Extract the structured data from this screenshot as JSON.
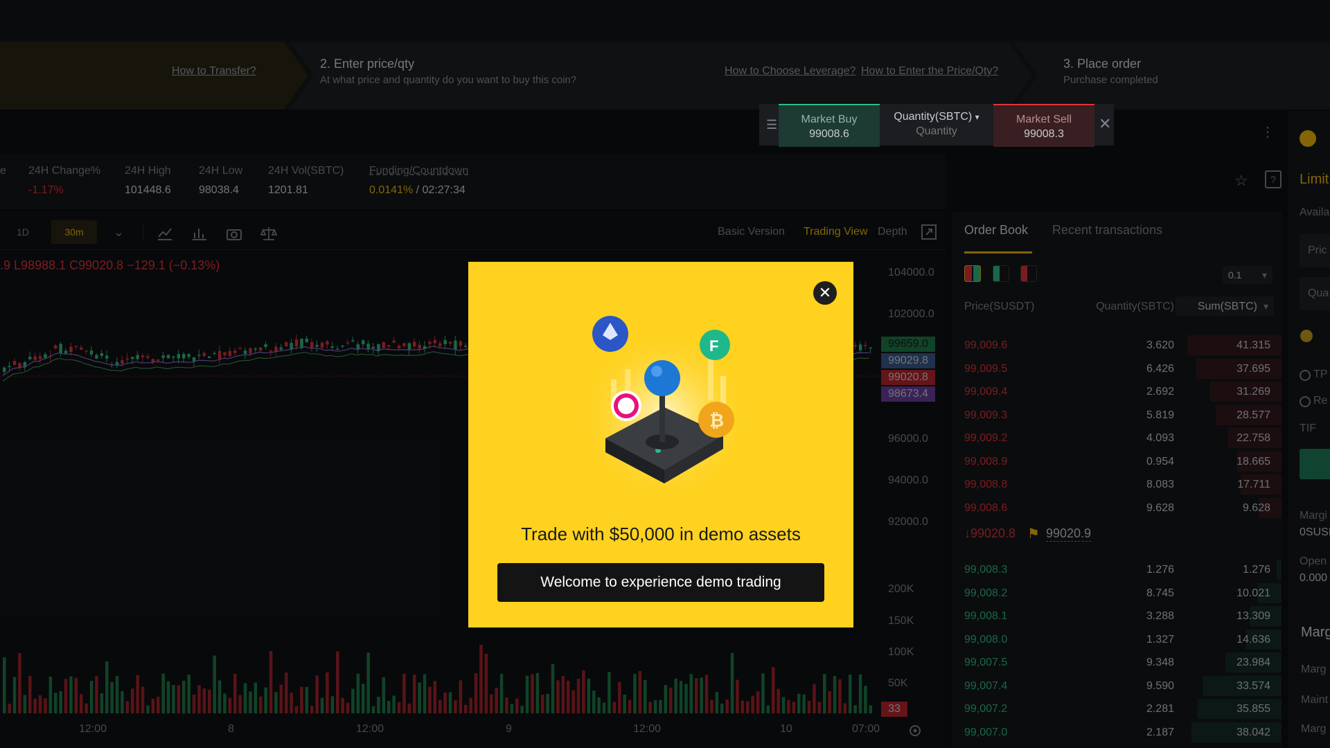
{
  "steps": {
    "link_transfer": "How to Transfer?",
    "step2_title": "2. Enter price/qty",
    "step2_sub": "At what price and quantity do you want to buy this coin?",
    "link_leverage": "How to Choose Leverage?",
    "link_price_qty": "How to Enter the Price/Qty?",
    "step3_title": "3. Place order",
    "step3_sub": "Purchase completed"
  },
  "quick_order": {
    "market_buy_label": "Market Buy",
    "market_buy_price": "99008.6",
    "quantity_label": "Quantity(SBTC)",
    "quantity_placeholder": "Quantity",
    "market_sell_label": "Market Sell",
    "market_sell_price": "99008.3"
  },
  "stats": [
    {
      "k": "24H Change%",
      "v": "-1.17%"
    },
    {
      "k": "24H High",
      "v": "101448.6"
    },
    {
      "k": "24H Low",
      "v": "98038.4"
    },
    {
      "k": "24H Vol(SBTC)",
      "v": "1201.81"
    }
  ],
  "funding": {
    "k": "Funding/Countdown",
    "rate": "0.0141%",
    "sep": " / ",
    "countdown": "02:27:34"
  },
  "chart_tools": {
    "interval_1d": "1D",
    "interval_30m": "30m",
    "basic": "Basic Version",
    "trading_view": "Trading View",
    "depth": "Depth"
  },
  "ohlc": {
    "l": "L98988.1",
    "c": "C99020.8",
    "chg": "−129.1 (−0.13%)",
    "prefix": ".9"
  },
  "price_axis": [
    "104000.0",
    "102000.0",
    "96000.0",
    "94000.0",
    "92000.0"
  ],
  "price_tags": [
    {
      "v": "99659.0",
      "color": "#1f7a4a"
    },
    {
      "v": "99029.8",
      "color": "#3a5a8a"
    },
    {
      "v": "99020.8",
      "color": "#b8272c"
    },
    {
      "v": "98673.4",
      "color": "#6b3fa0"
    }
  ],
  "vol_axis": [
    "200K",
    "150K",
    "100K",
    "50K"
  ],
  "vol_tag": "33",
  "time_axis": [
    "12:00",
    "8",
    "12:00",
    "9",
    "12:00",
    "10",
    "07:00"
  ],
  "orderbook": {
    "tab_book": "Order Book",
    "tab_recent": "Recent transactions",
    "precision": "0.1",
    "h_price": "Price(SUSDT)",
    "h_qty": "Quantity(SBTC)",
    "h_sum": "Sum(SBTC)",
    "asks": [
      {
        "p": "99,009.6",
        "q": "3.620",
        "s": "41.315",
        "w": 0.62
      },
      {
        "p": "99,009.5",
        "q": "6.426",
        "s": "37.695",
        "w": 0.56
      },
      {
        "p": "99,009.4",
        "q": "2.692",
        "s": "31.269",
        "w": 0.47
      },
      {
        "p": "99,009.3",
        "q": "5.819",
        "s": "28.577",
        "w": 0.43
      },
      {
        "p": "99,009.2",
        "q": "4.093",
        "s": "22.758",
        "w": 0.35
      },
      {
        "p": "99,008.9",
        "q": "0.954",
        "s": "18.665",
        "w": 0.29
      },
      {
        "p": "99,008.8",
        "q": "8.083",
        "s": "17.711",
        "w": 0.27
      },
      {
        "p": "99,008.6",
        "q": "9.628",
        "s": "9.628",
        "w": 0.15
      }
    ],
    "last_price": "↓99020.8",
    "mark_price": "99020.9",
    "bids": [
      {
        "p": "99,008.3",
        "q": "1.276",
        "s": "1.276",
        "w": 0.03
      },
      {
        "p": "99,008.2",
        "q": "8.745",
        "s": "10.021",
        "w": 0.16
      },
      {
        "p": "99,008.1",
        "q": "3.288",
        "s": "13.309",
        "w": 0.21
      },
      {
        "p": "99,008.0",
        "q": "1.327",
        "s": "14.636",
        "w": 0.23
      },
      {
        "p": "99,007.5",
        "q": "9.348",
        "s": "23.984",
        "w": 0.37
      },
      {
        "p": "99,007.4",
        "q": "9.590",
        "s": "33.574",
        "w": 0.52
      },
      {
        "p": "99,007.2",
        "q": "2.281",
        "s": "35.855",
        "w": 0.55
      },
      {
        "p": "99,007.0",
        "q": "2.187",
        "s": "38.042",
        "w": 0.59
      }
    ]
  },
  "right_panel": {
    "limit": "Limit",
    "avail": "Availa",
    "price": "Pric",
    "qty": "Qua",
    "tp": "TP",
    "re": "Re",
    "tif": "TIF",
    "marg1": "Margi",
    "marg1v": "0SUSI",
    "open": "Open",
    "openv": "0.000",
    "margin_h": "Marg",
    "marg2": "Marg",
    "maint": "Maint",
    "marg3": "Marg"
  },
  "modal": {
    "title": "Trade with $50,000 in demo assets",
    "cta": "Welcome to experience demo trading",
    "close": "✕"
  },
  "colors": {
    "up": "#2ebd85",
    "down": "#e0343c",
    "accent": "#f0b90b",
    "modal_bg": "#ffd21f"
  }
}
